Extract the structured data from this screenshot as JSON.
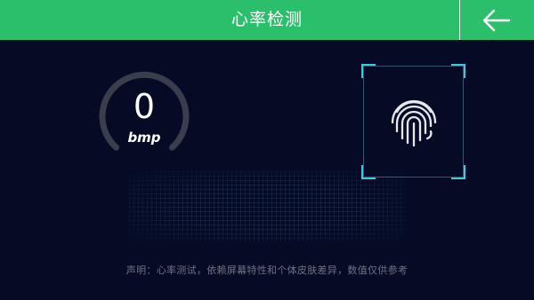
{
  "header": {
    "title": "心率检测",
    "back_icon": "arrow-left-icon",
    "bg_color": "#2cbf6b"
  },
  "gauge": {
    "value": "0",
    "unit": "bmp"
  },
  "scanner": {
    "icon": "fingerprint-icon",
    "corner_color": "#45c8d6"
  },
  "footer": {
    "disclaimer": "声明：心率测试，依赖屏幕特性和个体皮肤差异，数值仅供参考"
  }
}
